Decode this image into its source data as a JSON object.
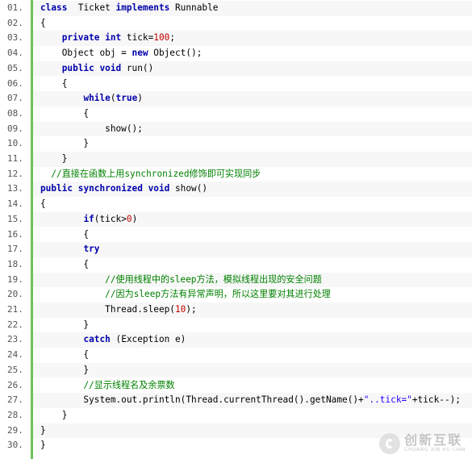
{
  "line_numbers": [
    "01.",
    "02.",
    "03.",
    "04.",
    "05.",
    "06.",
    "07.",
    "08.",
    "09.",
    "10.",
    "11.",
    "12.",
    "13.",
    "14.",
    "15.",
    "16.",
    "17.",
    "18.",
    "19.",
    "20.",
    "21.",
    "22.",
    "23.",
    "24.",
    "25.",
    "26.",
    "27.",
    "28.",
    "29.",
    "30."
  ],
  "lines": [
    [
      [
        "kw",
        "class"
      ],
      [
        "",
        "  Ticket "
      ],
      [
        "kw",
        "implements"
      ],
      [
        "",
        " Runnable"
      ]
    ],
    [
      [
        "",
        "{"
      ]
    ],
    [
      [
        "",
        "    "
      ],
      [
        "kw",
        "private"
      ],
      [
        "",
        " "
      ],
      [
        "kw",
        "int"
      ],
      [
        "",
        " tick="
      ],
      [
        "num",
        "100"
      ],
      [
        "",
        ";"
      ]
    ],
    [
      [
        "",
        "    Object obj = "
      ],
      [
        "kw",
        "new"
      ],
      [
        "",
        " Object();"
      ]
    ],
    [
      [
        "",
        "    "
      ],
      [
        "kw",
        "public"
      ],
      [
        "",
        " "
      ],
      [
        "kw",
        "void"
      ],
      [
        "",
        " run()"
      ]
    ],
    [
      [
        "",
        "    {"
      ]
    ],
    [
      [
        "",
        "        "
      ],
      [
        "kw",
        "while"
      ],
      [
        "",
        "("
      ],
      [
        "kw",
        "true"
      ],
      [
        "",
        ")"
      ]
    ],
    [
      [
        "",
        "        {"
      ]
    ],
    [
      [
        "",
        "            show();"
      ]
    ],
    [
      [
        "",
        "        }"
      ]
    ],
    [
      [
        "",
        "    }"
      ]
    ],
    [
      [
        "cm",
        "  //直接在函数上用synchronized修饰即可实现同步"
      ]
    ],
    [
      [
        "kw",
        "public"
      ],
      [
        "",
        " "
      ],
      [
        "kw",
        "synchronized"
      ],
      [
        "",
        " "
      ],
      [
        "kw",
        "void"
      ],
      [
        "",
        " show()"
      ]
    ],
    [
      [
        "",
        "{"
      ]
    ],
    [
      [
        "",
        "        "
      ],
      [
        "kw",
        "if"
      ],
      [
        "",
        "(tick>"
      ],
      [
        "num",
        "0"
      ],
      [
        "",
        ")"
      ]
    ],
    [
      [
        "",
        "        {"
      ]
    ],
    [
      [
        "",
        "        "
      ],
      [
        "kw",
        "try"
      ]
    ],
    [
      [
        "",
        "        {"
      ]
    ],
    [
      [
        "",
        "            "
      ],
      [
        "cm",
        "//使用线程中的sleep方法，模拟线程出现的安全问题"
      ]
    ],
    [
      [
        "",
        "            "
      ],
      [
        "cm",
        "//因为sleep方法有异常声明，所以这里要对其进行处理"
      ]
    ],
    [
      [
        "",
        "            Thread.sleep("
      ],
      [
        "num",
        "10"
      ],
      [
        "",
        ");"
      ]
    ],
    [
      [
        "",
        "        }"
      ]
    ],
    [
      [
        "",
        "        "
      ],
      [
        "kw",
        "catch"
      ],
      [
        "",
        " (Exception e)"
      ]
    ],
    [
      [
        "",
        "        {"
      ]
    ],
    [
      [
        "",
        "        }"
      ]
    ],
    [
      [
        "",
        "        "
      ],
      [
        "cm",
        "//显示线程名及余票数"
      ]
    ],
    [
      [
        "",
        "        System.out.println(Thread.currentThread().getName()+"
      ],
      [
        "str",
        "\"..tick=\""
      ],
      [
        "",
        "+tick--);"
      ]
    ],
    [
      [
        "",
        "    }"
      ]
    ],
    [
      [
        "",
        "}"
      ]
    ],
    [
      [
        "",
        "}"
      ]
    ]
  ],
  "watermark": {
    "cn": "创新互联",
    "en": "CHUANG XIN HU LIAN"
  }
}
